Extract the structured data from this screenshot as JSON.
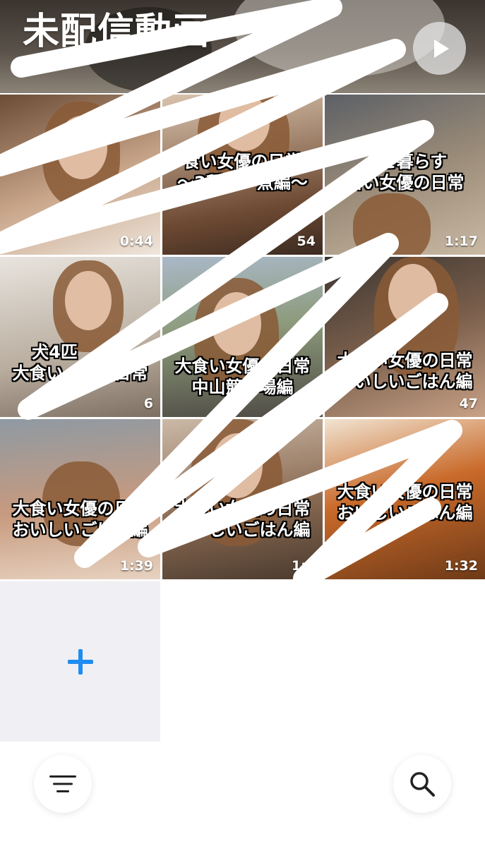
{
  "album": {
    "title": "未配信動画",
    "subtitle": "",
    "play_button": "play-icon"
  },
  "videos": [
    {
      "caption": "",
      "duration": "0:44"
    },
    {
      "caption": "食い女優の日常\n〜2種の　煮編〜",
      "duration": "54"
    },
    {
      "caption": "　と暮らす\n食い女優の日常",
      "duration": "1:17"
    },
    {
      "caption": "犬4匹　　す\n大食い　　の日常",
      "duration": "6"
    },
    {
      "caption": "大食い女優の日常\n中山競　場編",
      "duration": "1:3"
    },
    {
      "caption": "大食い女優の日常\nおいしいごはん編",
      "duration": "47"
    },
    {
      "caption": "大食い女優の日常\nおいしいごはん編",
      "duration": "1:39"
    },
    {
      "caption": "大食い女優の日常\nおいしいごはん編",
      "duration": "1:4"
    },
    {
      "caption": "大食い女優の日常\nおいしいごはん編",
      "duration": "1:32"
    }
  ],
  "add_tile": {
    "icon": "plus-icon",
    "color": "#1f8cf2"
  },
  "toolbar": {
    "left_icon": "sort-icon",
    "right_icon": "search-icon"
  }
}
